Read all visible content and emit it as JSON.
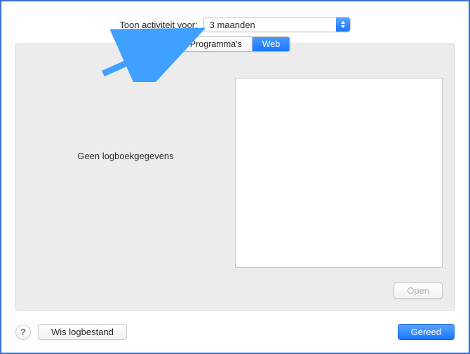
{
  "header": {
    "dropdown_label": "Toon activiteit voor:",
    "dropdown_value": "3 maanden"
  },
  "tabs": {
    "programs": "Programma's",
    "web": "Web",
    "active": "web"
  },
  "main": {
    "empty_message": "Geen logboekgegevens",
    "open_button": "Open"
  },
  "footer": {
    "help_symbol": "?",
    "clear_log_button": "Wis logbestand",
    "done_button": "Gereed"
  },
  "colors": {
    "accent": "#1877ff",
    "panel_bg": "#ececec"
  }
}
